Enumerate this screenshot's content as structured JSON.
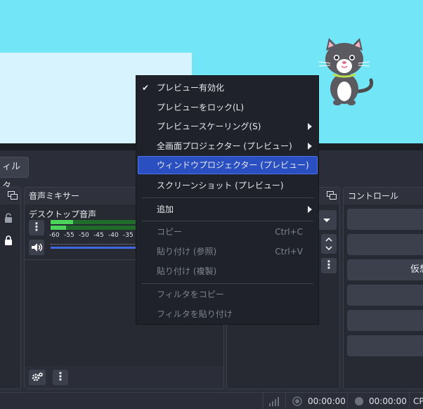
{
  "toolbar": {
    "filter_label": "ィルタ"
  },
  "mixer": {
    "title": "音声ミキサー",
    "source_name": "デスクトップ音声",
    "ticks": [
      "-60",
      "-55",
      "-50",
      "-45",
      "-40",
      "-35",
      "-3"
    ]
  },
  "controls": {
    "title": "コントロール",
    "button_partial": "仮想"
  },
  "status": {
    "time1": "00:00:00",
    "time2": "00:00:00",
    "cpu": "CP"
  },
  "menu": {
    "items": [
      {
        "label": "プレビュー有効化",
        "checked": true
      },
      {
        "label": "プレビューをロック(L)"
      },
      {
        "label": "プレビュースケーリング(S)",
        "submenu": true
      },
      {
        "label": "全画面プロジェクター (プレビュー)",
        "submenu": true
      },
      {
        "label": "ウィンドウプロジェクター (プレビュー)",
        "highlighted": true
      },
      {
        "label": "スクリーンショット (プレビュー)"
      },
      {
        "label": "追加",
        "submenu": true
      },
      {
        "label": "コピー",
        "shortcut": "Ctrl+C",
        "disabled": true
      },
      {
        "label": "貼り付け (参照)",
        "shortcut": "Ctrl+V",
        "disabled": true
      },
      {
        "label": "貼り付け (複製)",
        "disabled": true
      },
      {
        "label": "フィルタをコピー",
        "disabled": true
      },
      {
        "label": "フィルタを貼り付け",
        "disabled": true
      }
    ]
  },
  "colors": {
    "preview_bg": "#72e6f6",
    "menu_bg": "#1f222a",
    "highlight": "#2a4fc1",
    "meter_green": "#4bd35a"
  }
}
